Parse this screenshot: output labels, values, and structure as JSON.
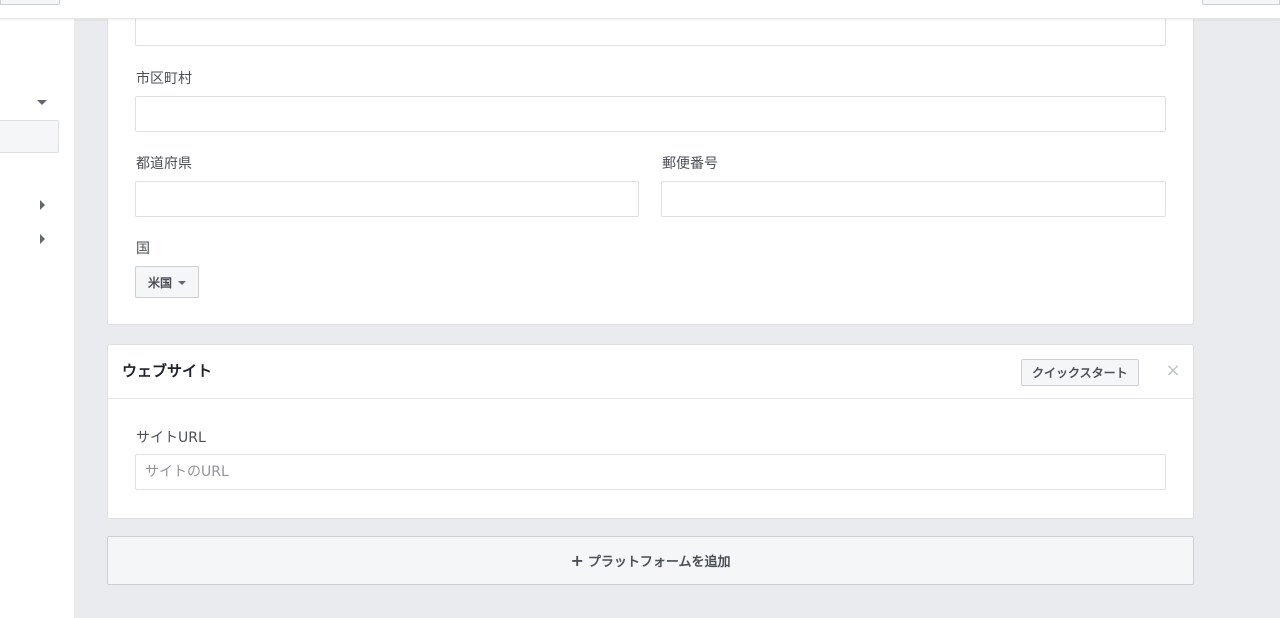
{
  "address": {
    "city_label": "市区町村",
    "prefecture_label": "都道府県",
    "postal_label": "郵便番号",
    "country_label": "国",
    "country_value": "米国"
  },
  "website": {
    "title": "ウェブサイト",
    "quickstart_label": "クイックスタート",
    "close_label": "×",
    "site_url_label": "サイトURL",
    "site_url_placeholder": "サイトのURL"
  },
  "add_platform": {
    "plus": "+",
    "label": "プラットフォームを追加"
  },
  "icons": {
    "caret_down": "caret-down-icon",
    "caret_right": "caret-right-icon",
    "close": "close-icon",
    "plus": "plus-icon"
  }
}
